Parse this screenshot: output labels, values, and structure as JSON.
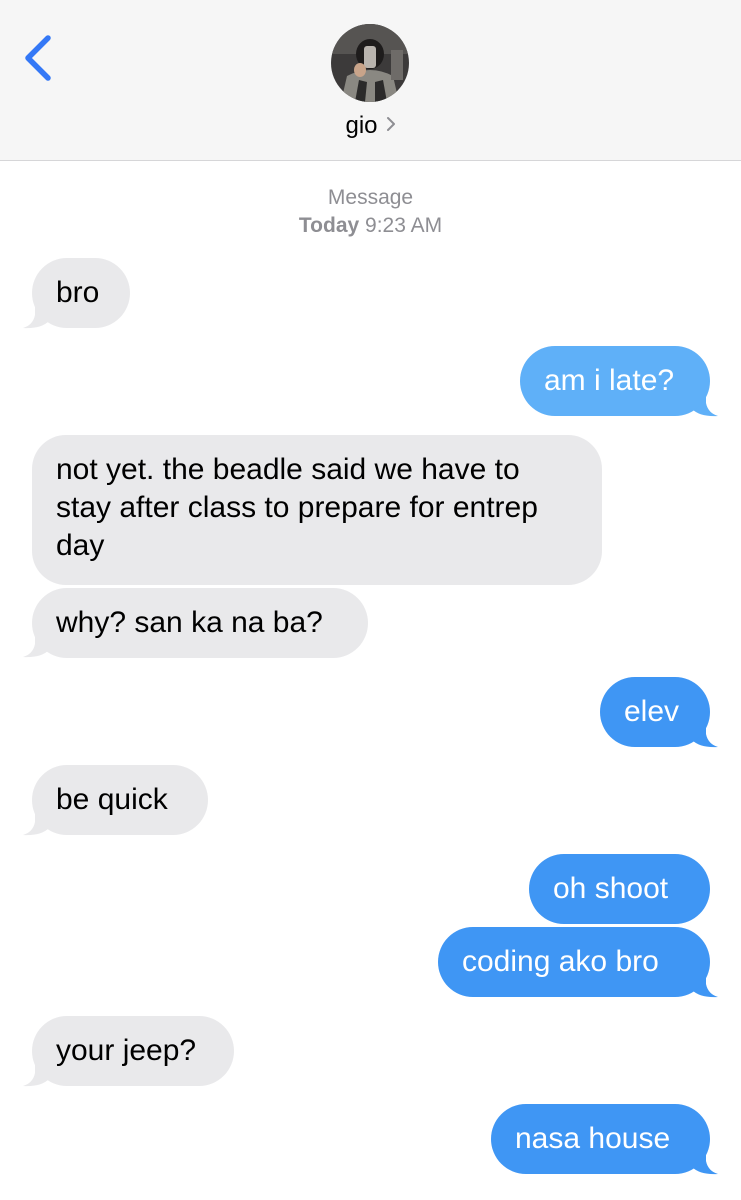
{
  "header": {
    "contact_name": "gio",
    "back_icon": "chevron-left-icon",
    "accent": "#3478f6"
  },
  "thread": {
    "service_label": "Message",
    "day_label": "Today",
    "time_label": "9:23 AM"
  },
  "messages": [
    {
      "dir": "in",
      "text": "bro"
    },
    {
      "dir": "out",
      "text": "am i late?"
    },
    {
      "dir": "in",
      "text": "not yet. the beadle said we have to stay after class to prepare for entrep day"
    },
    {
      "dir": "in",
      "text": "why? san ka na ba?"
    },
    {
      "dir": "out",
      "text": "elev"
    },
    {
      "dir": "in",
      "text": "be quick"
    },
    {
      "dir": "out",
      "text": "oh shoot"
    },
    {
      "dir": "out",
      "text": "coding ako bro"
    },
    {
      "dir": "in",
      "text": "your jeep?"
    },
    {
      "dir": "out",
      "text": "nasa house"
    }
  ],
  "colors": {
    "incoming_bubble": "#e9e9eb",
    "outgoing_bubble": "#3f96f4",
    "meta_text": "#8e8e93"
  }
}
